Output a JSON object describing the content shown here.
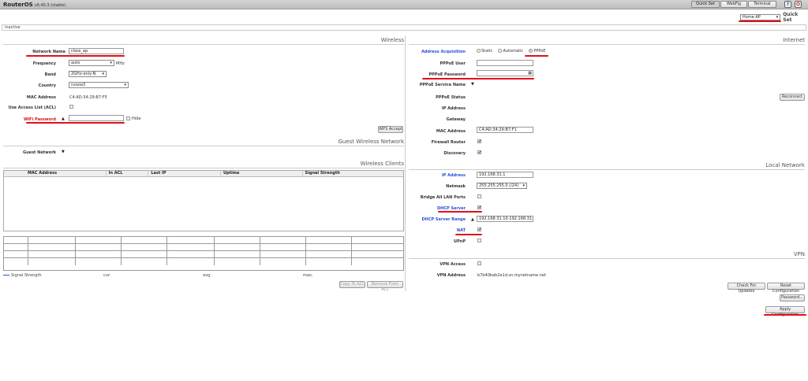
{
  "app": {
    "title": "RouterOS",
    "version": "v6.40.3 (stable)"
  },
  "toolbar": {
    "tabs": [
      "Quick Set",
      "WebFig",
      "Terminal"
    ],
    "help": "?"
  },
  "quickset": {
    "mode": "Home AP",
    "label": "Quick Set"
  },
  "status": "inactive",
  "wireless": {
    "title": "Wireless",
    "network_name_label": "Network Name",
    "network_name": "class_ap",
    "frequency_label": "Frequency",
    "frequency": "auto",
    "frequency_unit": "MHz",
    "band_label": "Band",
    "band": "2GHz-only-N",
    "country_label": "Country",
    "country": "russia3",
    "mac_label": "MAC Address",
    "mac": "C4:AD:34:29:B7:F5",
    "acl_label": "Use Access List (ACL)",
    "wifi_password_label": "WiFi Password",
    "hide_label": "Hide",
    "wps_button": "WPS Accept"
  },
  "guest": {
    "title": "Guest Wireless Network",
    "label": "Guest Network"
  },
  "clients": {
    "title": "Wireless Clients",
    "columns": [
      "MAC Address",
      "In ACL",
      "Last IP",
      "Uptime",
      "Signal Strength"
    ],
    "legend": {
      "series": "Signal Strength",
      "cur": "cur:",
      "avg": "avg:",
      "max": "max:"
    },
    "copy_button": "Copy To ACL",
    "remove_button": "Remove From ACL"
  },
  "internet": {
    "title": "Internet",
    "acq_label": "Address Acquisition",
    "acq_options": [
      "Static",
      "Automatic",
      "PPPoE"
    ],
    "acq_selected": "PPPoE",
    "pppoe_user_label": "PPPoE User",
    "pppoe_password_label": "PPPoE Password",
    "pppoe_service_label": "PPPoE Service Name",
    "pppoe_status_label": "PPPoE Status",
    "reconnect_button": "Reconnect",
    "ip_label": "IP Address",
    "gateway_label": "Gateway",
    "mac_label": "MAC Address",
    "mac": "C4:AD:34:29:B7:F1",
    "firewall_label": "Firewall Router",
    "discovery_label": "Discovery"
  },
  "local": {
    "title": "Local Network",
    "ip_label": "IP Address",
    "ip": "192.168.31.1",
    "netmask_label": "Netmask",
    "netmask": "255.255.255.0 (/24)",
    "bridge_label": "Bridge All LAN Ports",
    "dhcp_label": "DHCP Server",
    "dhcp_range_label": "DHCP Server Range",
    "dhcp_range": "192.168.31.10-192.168.31.2",
    "nat_label": "NAT",
    "upnp_label": "UPnP"
  },
  "vpn": {
    "title": "VPN",
    "access_label": "VPN Access",
    "address_label": "VPN Address",
    "address": "b7b40bab2e1d.sn.mynetname.net"
  },
  "actions": {
    "check_updates": "Check For Updates",
    "reset": "Reset Configuration",
    "password": "Password...",
    "apply": "Apply Configuration"
  },
  "colors": {
    "annotation": "#e0101a",
    "blue_label": "#2a4fd6"
  }
}
